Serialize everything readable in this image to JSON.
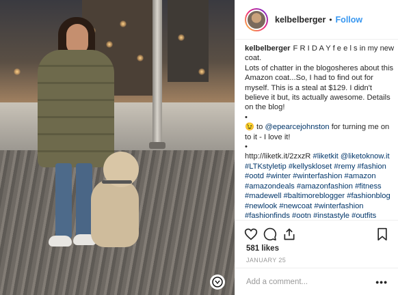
{
  "header": {
    "username": "kelbelberger",
    "separator": "•",
    "follow_label": "Follow"
  },
  "caption": {
    "username": "kelbelberger",
    "text_1": "F R I D A Y f e e l s in my new coat.",
    "text_2": "Lots of chatter in the blogosheres about this Amazon coat...So, I had to find out for myself. This is a steal at $129. I didn't believe it but, its actually awesome. Details on the blog!",
    "bullet_1": "•",
    "emoji_1": "😉",
    "to_word": "to",
    "mention": "@epearcejohnston",
    "text_3": "for turning me on to it - I love it!",
    "bullet_2": "•",
    "link": "http://liketk.it/2zxzR",
    "hashtags": "#liketkit @liketoknow.it #LTKstyletip #kellyskloset #remy #fashion #ootd #winter #winterfashion #amazon #amazondeals #amazonfashion #fitness #madewell #baltimoreblogger #fashionblog #newlook #newcoat #winterfashion #fashionfinds #ootn #instastyle #outfits #outfitinspo #outfitinspiration #fashiontrends #allbirds #orolayjacket"
  },
  "actions": {
    "like_icon": "heart-icon",
    "comment_icon": "comment-icon",
    "share_icon": "share-icon",
    "save_icon": "bookmark-icon"
  },
  "likes": "581 likes",
  "date": "JANUARY 25",
  "comment_bar": {
    "placeholder": "Add a comment...",
    "more": "•••"
  },
  "colors": {
    "link": "#003569",
    "follow": "#3897f0",
    "muted": "#999999"
  }
}
